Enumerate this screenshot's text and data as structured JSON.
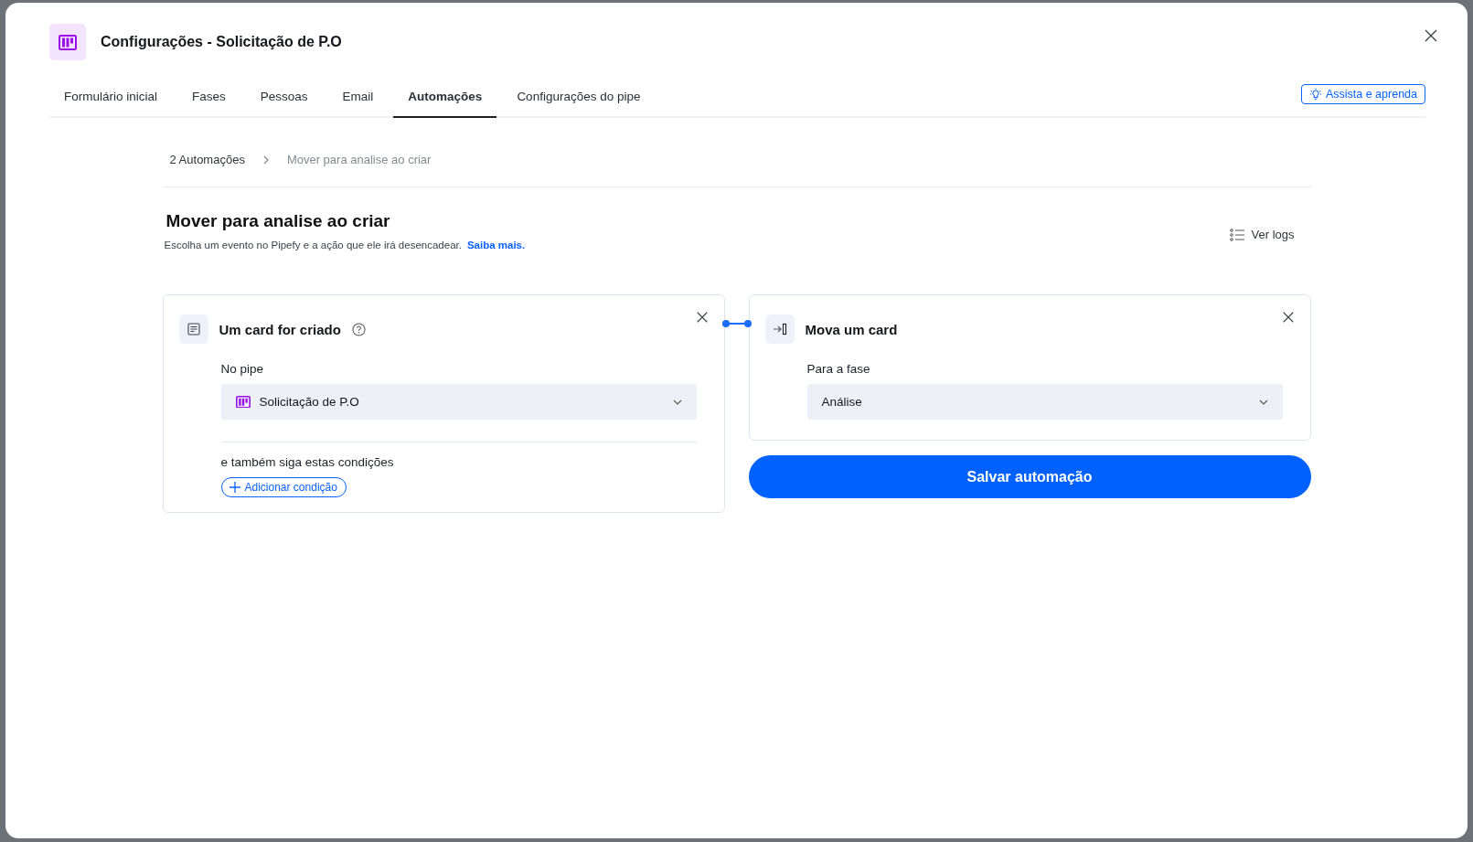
{
  "dialog": {
    "title": "Configurações - Solicitação de P.O"
  },
  "tabs": [
    {
      "label": "Formulário inicial",
      "selected": false
    },
    {
      "label": "Fases",
      "selected": false
    },
    {
      "label": "Pessoas",
      "selected": false
    },
    {
      "label": "Email",
      "selected": false
    },
    {
      "label": "Automações",
      "selected": true
    },
    {
      "label": "Configurações do pipe",
      "selected": false
    }
  ],
  "help_button": {
    "label": "Assista e aprenda"
  },
  "breadcrumb": [
    {
      "label": "2 Automações",
      "current": false
    },
    {
      "label": "Mover para analise ao criar",
      "current": true
    }
  ],
  "automation": {
    "title": "Mover para analise ao criar",
    "description": "Escolha um evento no Pipefy e a ação que ele irá desencadear.",
    "link": "Saiba mais.",
    "logs_button": "Ver logs"
  },
  "trigger": {
    "title": "Um card for criado",
    "field_label": "No pipe",
    "field_value": "Solicitação de P.O",
    "conditions_label": "e também siga estas condições",
    "add_condition": "Adicionar condição"
  },
  "action": {
    "title": "Mova um card",
    "field_label": "Para a fase",
    "field_value": "Análise"
  },
  "save_button": {
    "label": "Salvar automação"
  }
}
